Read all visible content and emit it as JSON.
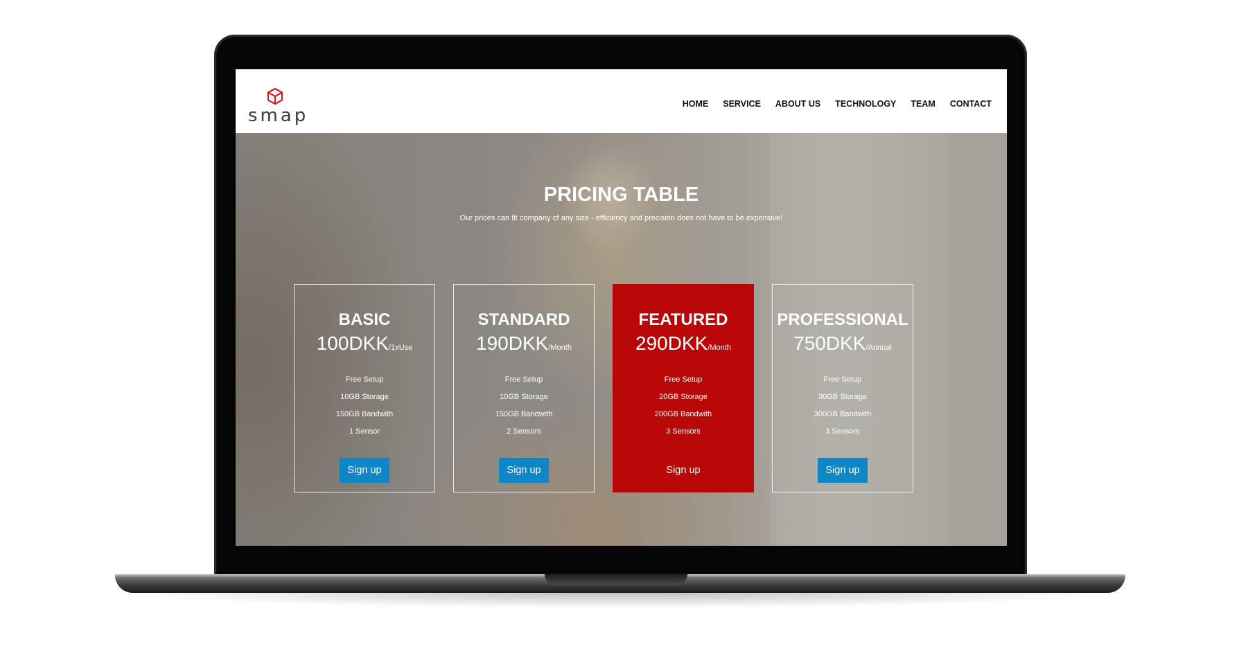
{
  "brand": {
    "logo_text": "smap",
    "logo_color": "#cf1f1f"
  },
  "nav": {
    "items": [
      "HOME",
      "SERVICE",
      "ABOUT US",
      "TECHNOLOGY",
      "TEAM",
      "CONTACT"
    ]
  },
  "hero": {
    "title": "PRICING TABLE",
    "subtitle": "Our prices can fit company of any size - efficiency and precision does not have to be expensive!"
  },
  "plans": [
    {
      "name": "BASIC",
      "price": "100DKK",
      "period": "/1xUse",
      "features": [
        "Free Setup",
        "10GB Storage",
        "150GB Bandwith",
        "1 Sensor"
      ],
      "button": "Sign up",
      "featured": false
    },
    {
      "name": "STANDARD",
      "price": "190DKK",
      "period": "/Month",
      "features": [
        "Free Setup",
        "10GB Storage",
        "150GB Bandwith",
        "2 Sensors"
      ],
      "button": "Sign up",
      "featured": false
    },
    {
      "name": "FEATURED",
      "price": "290DKK",
      "period": "/Month",
      "features": [
        "Free Setup",
        "20GB Storage",
        "200GB Bandwith",
        "3 Sensors"
      ],
      "button": "Sign up",
      "featured": true
    },
    {
      "name": "PROFESSIONAL",
      "price": "750DKK",
      "period": "/Annual",
      "features": [
        "Free Setup",
        "30GB Storage",
        "300GB Bandwith",
        "3 Sensors"
      ],
      "button": "Sign up",
      "featured": false
    }
  ],
  "colors": {
    "featured": "#b90606",
    "button": "#0f86c8"
  }
}
